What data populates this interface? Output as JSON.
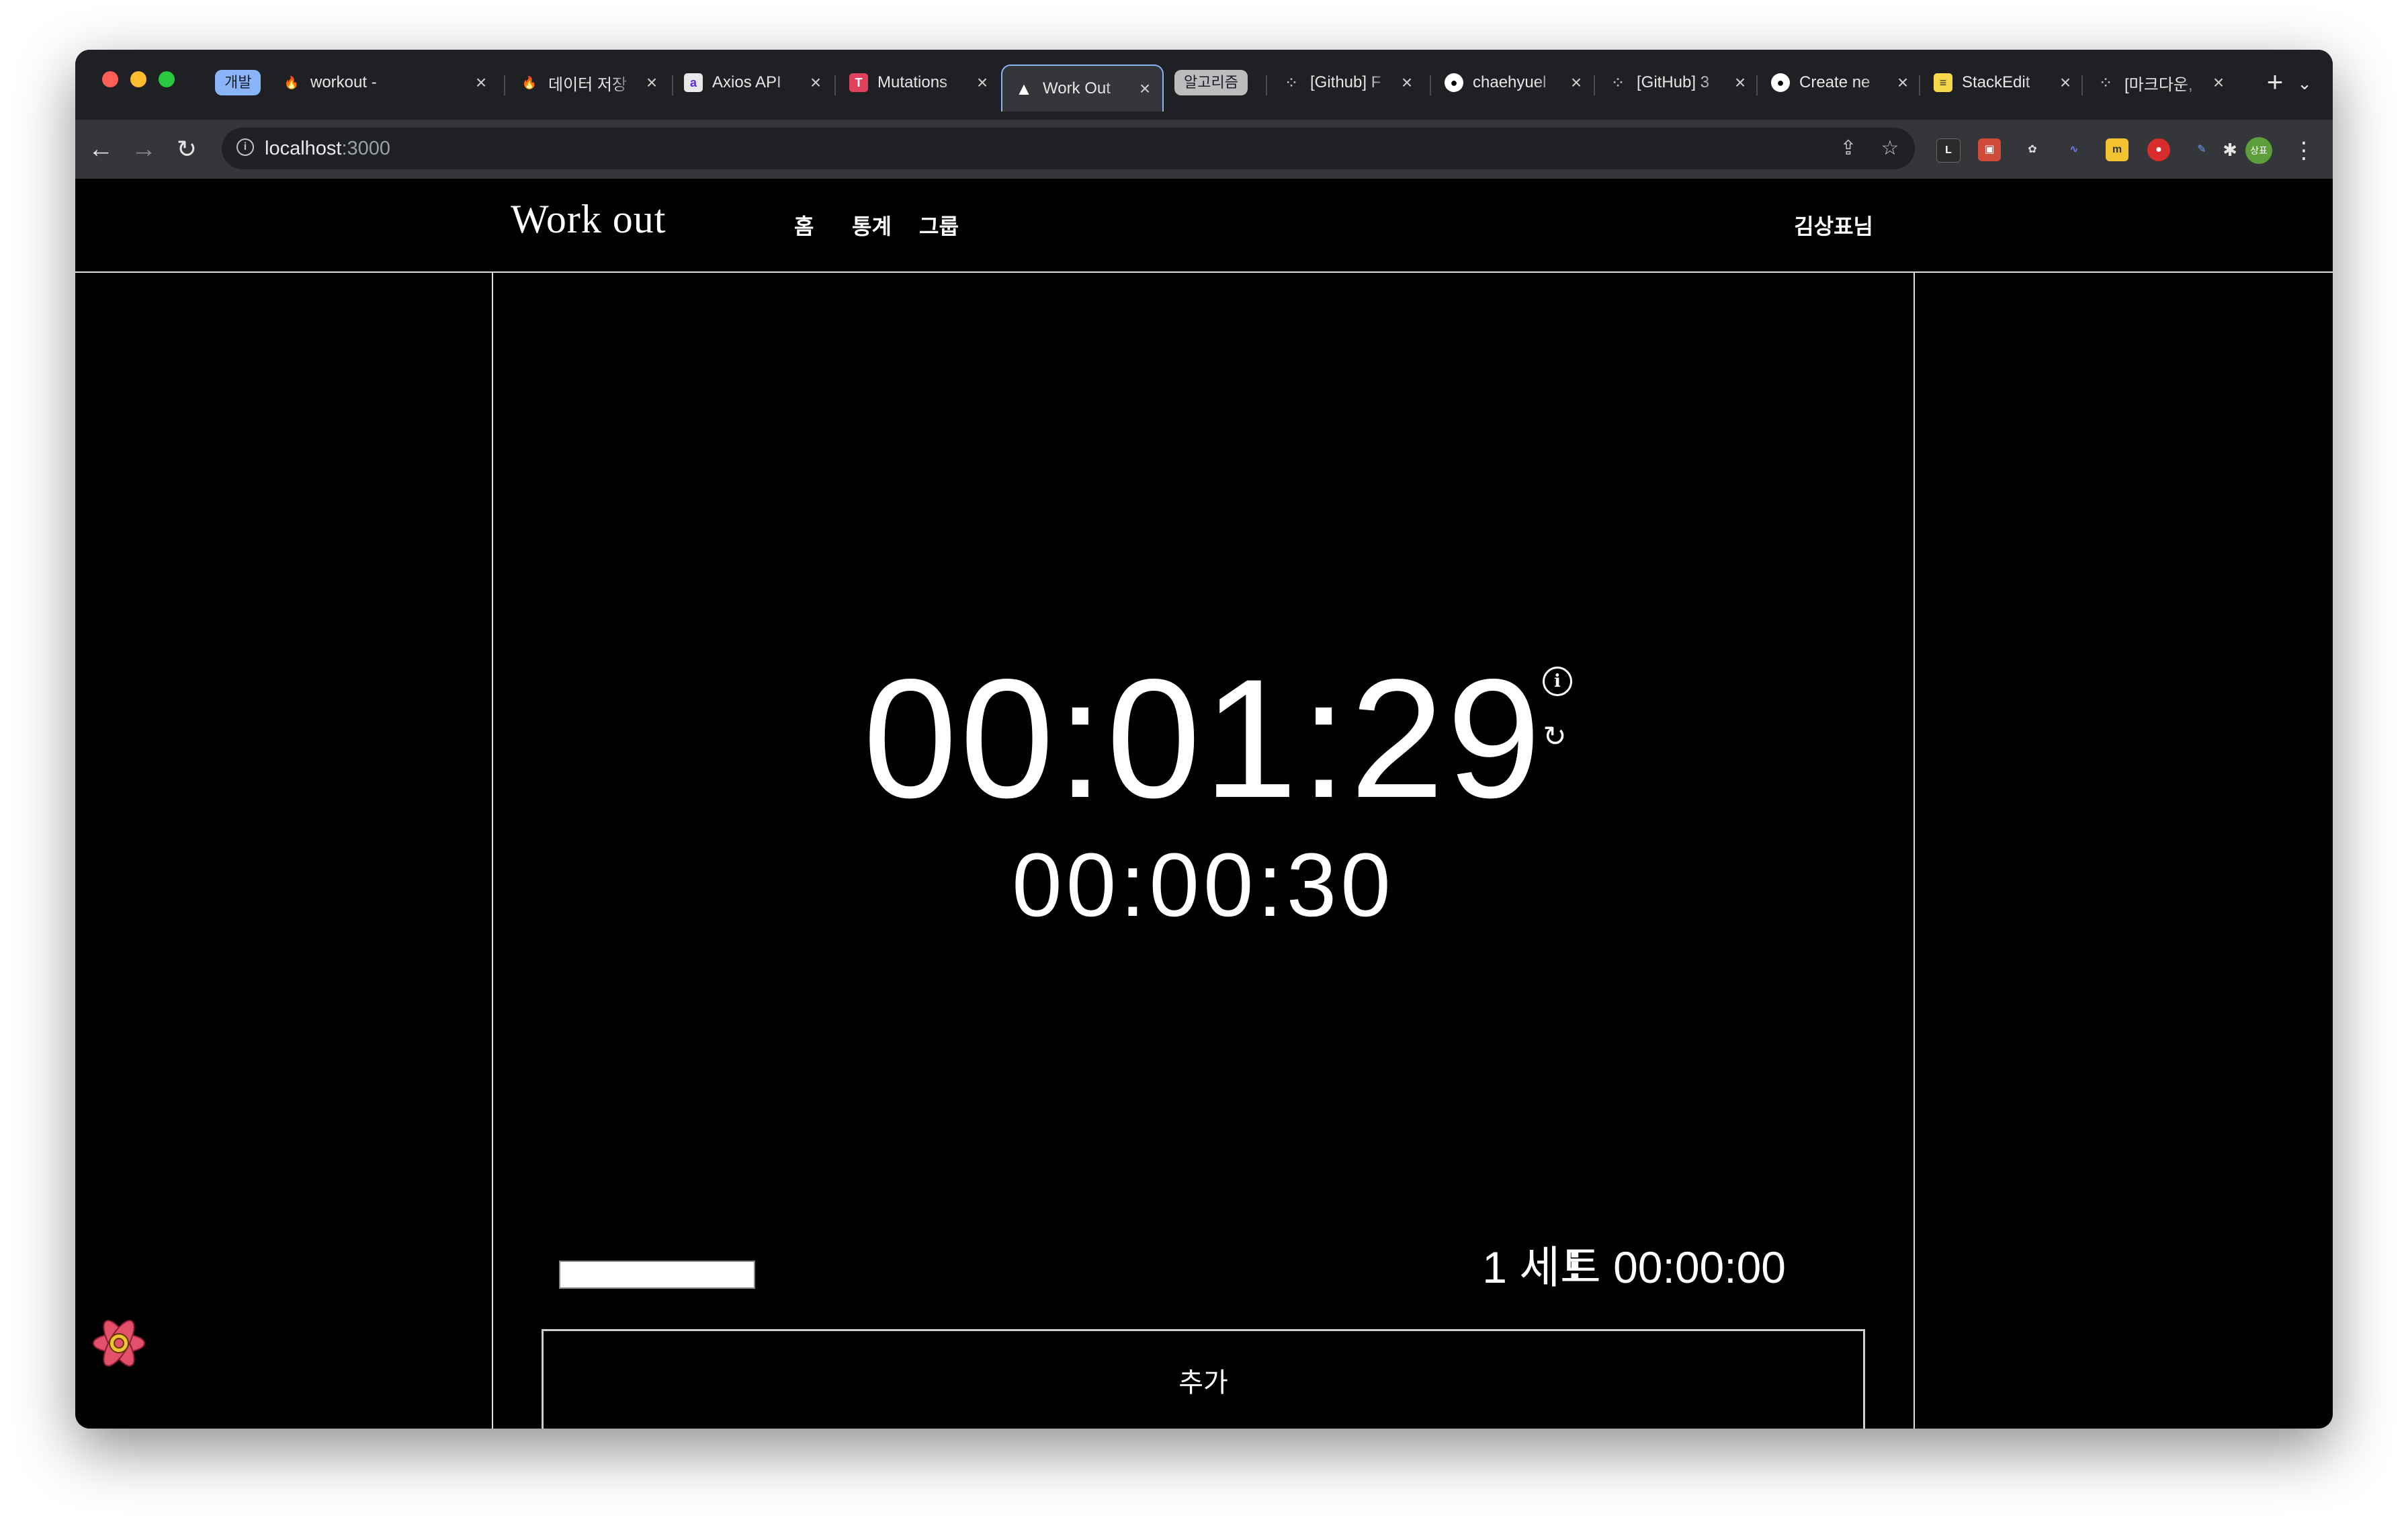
{
  "browser": {
    "tab_group_dev": "개발",
    "tab_group_algo": "알고리즘",
    "tabs": [
      {
        "title": "workout -",
        "icon": "firebase-icon"
      },
      {
        "title": "데이터 저장",
        "icon": "firebase-icon"
      },
      {
        "title": "Axios API",
        "icon": "axios-icon"
      },
      {
        "title": "Mutations",
        "icon": "tanstack-icon"
      },
      {
        "title": "Work Out",
        "icon": "vercel-icon",
        "active": true
      },
      {
        "title": "[Github] F",
        "icon": "tistory-icon"
      },
      {
        "title": "chaehyuel",
        "icon": "github-icon"
      },
      {
        "title": "[GitHub] 3",
        "icon": "tistory-icon"
      },
      {
        "title": "Create ne",
        "icon": "github-icon"
      },
      {
        "title": "StackEdit",
        "icon": "stackedit-icon"
      },
      {
        "title": "[마크다운, ",
        "icon": "tistory-icon"
      }
    ],
    "address": {
      "host": "localhost",
      "port": ":3000"
    },
    "profile_initials": "상표"
  },
  "app": {
    "brand": "Work out",
    "nav": {
      "home": "홈",
      "stats": "통계",
      "group": "그룹"
    },
    "user": "김상표님",
    "timer_total": "00:01:29",
    "timer_rest": "00:00:30",
    "set_input_value": "",
    "set_label": "1 세트 00:00:00",
    "add_button": "추가"
  },
  "colors": {
    "accent": "#8ab4f8",
    "background": "#000000",
    "text": "#ffffff"
  }
}
